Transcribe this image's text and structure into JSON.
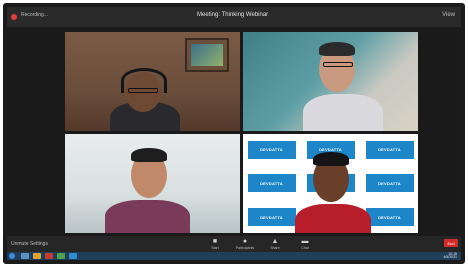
{
  "topbar": {
    "left_text": "Recording...",
    "meeting_title": "Meeting: Thinking Webinar",
    "view_label": "View"
  },
  "participants": [
    {
      "name": ""
    },
    {
      "name": ""
    },
    {
      "name": ""
    },
    {
      "name": ""
    }
  ],
  "logo_wall": {
    "brand_text": "DEVDATTA",
    "accent_color": "#1d86c8"
  },
  "controls": {
    "left_label": "Unmute Settings",
    "items": [
      {
        "icon": "video-icon",
        "label": "Start"
      },
      {
        "icon": "participants-icon",
        "label": "Participants"
      },
      {
        "icon": "share-icon",
        "label": "Share"
      },
      {
        "icon": "chat-icon",
        "label": "Chat"
      }
    ],
    "end_label": "End",
    "end_color": "#d12b2b"
  },
  "taskbar": {
    "time": "10:15",
    "date": "4/5/2021"
  }
}
